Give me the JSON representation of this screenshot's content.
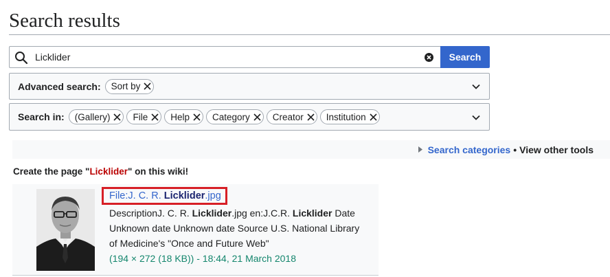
{
  "page": {
    "title": "Search results"
  },
  "search": {
    "value": "Licklider",
    "button_label": "Search",
    "icons": {
      "search": "magnifier-icon",
      "clear": "clear-circle-x-icon"
    }
  },
  "advanced": {
    "label": "Advanced search:",
    "chips": [
      {
        "label": "Sort by"
      }
    ]
  },
  "search_in": {
    "label": "Search in:",
    "chips": [
      {
        "label": "(Gallery)"
      },
      {
        "label": "File"
      },
      {
        "label": "Help"
      },
      {
        "label": "Category"
      },
      {
        "label": "Creator"
      },
      {
        "label": "Institution"
      }
    ]
  },
  "tools": {
    "categories_link": "Search categories",
    "separator": "•",
    "other_tools": "View other tools"
  },
  "create": {
    "prefix": "Create the page \"",
    "link": "Licklider",
    "suffix": "\" on this wiki!"
  },
  "result": {
    "title_prefix": "File:J. C. R. ",
    "title_bold": "Licklider",
    "title_suffix": ".jpg",
    "snippet_line1_a": "DescriptionJ. C. R. ",
    "snippet_line1_b": "Licklider",
    "snippet_line1_c": ".jpg en:J.C.R. ",
    "snippet_line1_d": "Licklider",
    "snippet_line1_e": " Date",
    "snippet_line2": "Unknown date Unknown date Source U.S. National Library",
    "snippet_line3": "of Medicine's \"Once and Future Web\"",
    "meta": "(194 × 272 (18 KB)) - 18:44, 21 March 2018"
  },
  "colors": {
    "accent": "#3366cc",
    "redlink": "#ba0000",
    "meta_green": "#14866d",
    "highlight_border": "#d71f26"
  }
}
